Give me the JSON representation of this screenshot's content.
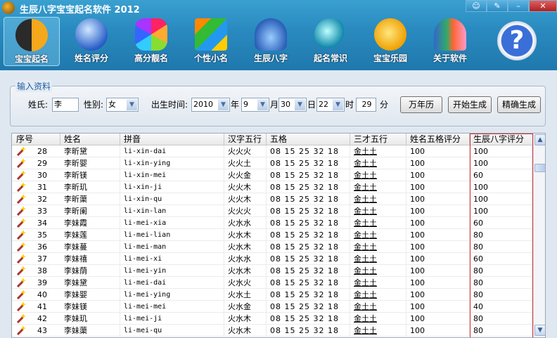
{
  "title": "生辰八字宝宝起名软件 2012",
  "window_buttons": [
    "☺",
    "✎",
    "–",
    "✕"
  ],
  "toolbar": [
    {
      "label": "宝宝起名",
      "icon": "yin-yang-icon",
      "active": true
    },
    {
      "label": "姓名评分",
      "icon": "globe-icon"
    },
    {
      "label": "高分靓名",
      "icon": "hexagons-icon"
    },
    {
      "label": "个性小名",
      "icon": "squares-icon"
    },
    {
      "label": "生辰八字",
      "icon": "petals-icon"
    },
    {
      "label": "起名常识",
      "icon": "bubble-icon"
    },
    {
      "label": "宝宝乐园",
      "icon": "chick-icon"
    },
    {
      "label": "关于软件",
      "icon": "butterfly-icon"
    },
    {
      "label": "",
      "icon": "help-icon"
    }
  ],
  "help_glyph": "?",
  "form": {
    "group_title": "输入资料",
    "surname_label": "姓氏:",
    "surname": "李",
    "gender_label": "性别:",
    "gender": "女",
    "birth_label": "出生时间:",
    "year": "2010",
    "year_unit": "年",
    "month": "9",
    "month_unit": "月",
    "day": "30",
    "day_unit": "日",
    "hour": "22",
    "hour_unit": "时",
    "minute": "29",
    "minute_unit": "分",
    "calendar_btn": "万年历",
    "start_btn": "开始生成",
    "precise_btn": "精确生成",
    "arrow": "▼"
  },
  "table": {
    "headers": [
      "序号",
      "姓名",
      "拼音",
      "汉字五行",
      "五格",
      "三才五行",
      "姓名五格评分",
      "生辰八字评分"
    ],
    "rows": [
      [
        "28",
        "李昕黛",
        "li-xin-dai",
        "火火火",
        "08 15 25 32 18",
        "金土土",
        "100",
        "100"
      ],
      [
        "29",
        "李昕婴",
        "li-xin-ying",
        "火火土",
        "08 15 25 32 18",
        "金土土",
        "100",
        "100"
      ],
      [
        "30",
        "李昕镁",
        "li-xin-mei",
        "火火金",
        "08 15 25 32 18",
        "金土土",
        "100",
        "60"
      ],
      [
        "31",
        "李昕玑",
        "li-xin-ji",
        "火火木",
        "08 15 25 32 18",
        "金土土",
        "100",
        "100"
      ],
      [
        "32",
        "李昕蕖",
        "li-xin-qu",
        "火火木",
        "08 15 25 32 18",
        "金土土",
        "100",
        "100"
      ],
      [
        "33",
        "李昕阑",
        "li-xin-lan",
        "火火火",
        "08 15 25 32 18",
        "金土土",
        "100",
        "100"
      ],
      [
        "34",
        "李妹霞",
        "li-mei-xia",
        "火水水",
        "08 15 25 32 18",
        "金土土",
        "100",
        "60"
      ],
      [
        "35",
        "李妹莲",
        "li-mei-lian",
        "火水木",
        "08 15 25 32 18",
        "金土土",
        "100",
        "80"
      ],
      [
        "36",
        "李妹蔓",
        "li-mei-man",
        "火水木",
        "08 15 25 32 18",
        "金土土",
        "100",
        "80"
      ],
      [
        "37",
        "李妹禧",
        "li-mei-xi",
        "火水水",
        "08 15 25 32 18",
        "金土土",
        "100",
        "60"
      ],
      [
        "38",
        "李妹荫",
        "li-mei-yin",
        "火水木",
        "08 15 25 32 18",
        "金土土",
        "100",
        "80"
      ],
      [
        "39",
        "李妹黛",
        "li-mei-dai",
        "火水火",
        "08 15 25 32 18",
        "金土土",
        "100",
        "80"
      ],
      [
        "40",
        "李妹婴",
        "li-mei-ying",
        "火水土",
        "08 15 25 32 18",
        "金土土",
        "100",
        "80"
      ],
      [
        "41",
        "李妹镁",
        "li-mei-mei",
        "火水金",
        "08 15 25 32 18",
        "金土土",
        "100",
        "40"
      ],
      [
        "42",
        "李妹玑",
        "li-mei-ji",
        "火水木",
        "08 15 25 32 18",
        "金土土",
        "100",
        "80"
      ],
      [
        "43",
        "李妹蕖",
        "li-mei-qu",
        "火水木",
        "08 15 25 32 18",
        "金土土",
        "100",
        "80"
      ]
    ],
    "scroll_up": "▲",
    "scroll_down": "▼"
  }
}
